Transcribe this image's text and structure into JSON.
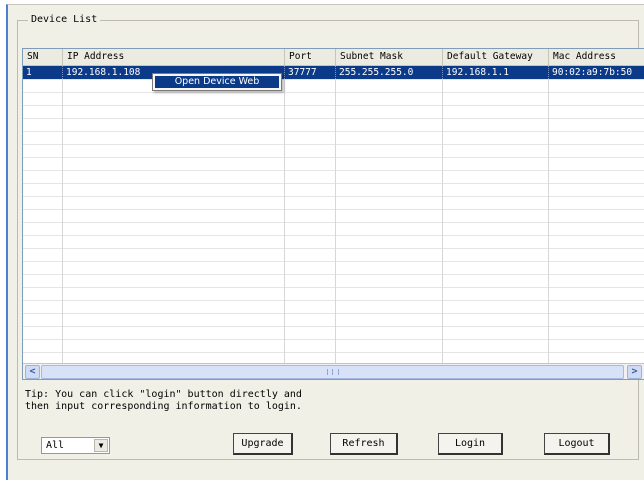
{
  "group_title": "Device List",
  "table": {
    "columns": [
      "SN",
      "IP Address",
      "Port",
      "Subnet Mask",
      "Default Gateway",
      "Mac Address"
    ],
    "rows": [
      {
        "sn": "1",
        "ip": "192.168.1.108",
        "port": "37777",
        "subnet": "255.255.255.0",
        "gateway": "192.168.1.1",
        "mac": "90:02:a9:7b:50"
      }
    ]
  },
  "context_menu": {
    "item": "Open Device Web"
  },
  "scrollbar": {
    "left_arrow": "<",
    "right_arrow": ">"
  },
  "tip": {
    "line1": "Tip: You can click \"login\" button directly and",
    "line2": "then input corresponding information to login."
  },
  "filter": {
    "value": "All",
    "arrow": "▼"
  },
  "buttons": {
    "upgrade": "Upgrade",
    "refresh": "Refresh",
    "login": "Login",
    "logout": "Logout"
  },
  "colors": {
    "selection": "#0b3a88",
    "window_bg": "#f1f0e7"
  }
}
